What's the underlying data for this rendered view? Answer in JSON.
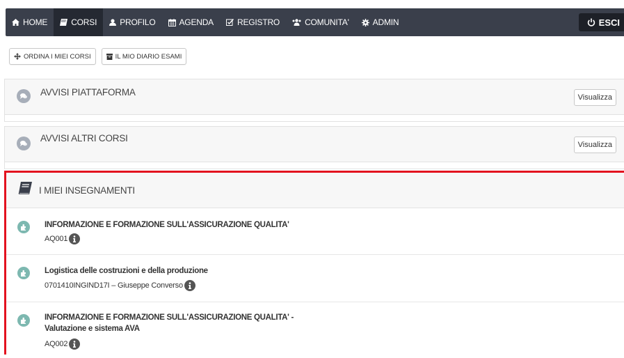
{
  "nav": {
    "items": [
      {
        "label": "HOME",
        "icon": "home-icon"
      },
      {
        "label": "CORSI",
        "icon": "book-icon",
        "active": true
      },
      {
        "label": "PROFILO",
        "icon": "user-icon"
      },
      {
        "label": "AGENDA",
        "icon": "calendar-icon"
      },
      {
        "label": "REGISTRO",
        "icon": "check-square-icon"
      },
      {
        "label": "COMUNITA'",
        "icon": "users-icon"
      },
      {
        "label": "ADMIN",
        "icon": "gear-icon"
      }
    ],
    "exit_label": "ESCI"
  },
  "toolbar": {
    "order_label": "ORDINA I MIEI CORSI",
    "diary_label": "IL MIO DIARIO ESAMI"
  },
  "notices": [
    {
      "title": "AVVISI PIATTAFORMA",
      "button": "Visualizza"
    },
    {
      "title": "AVVISI ALTRI CORSI",
      "button": "Visualizza"
    }
  ],
  "teachings": {
    "title": "I MIEI INSEGNAMENTI",
    "courses": [
      {
        "title": "INFORMAZIONE E FORMAZIONE SULL'ASSICURAZIONE QUALITA'",
        "code": "AQ001"
      },
      {
        "title": "Logistica delle costruzioni e della produzione",
        "code": "0701410INGIND17I –  Giuseppe Converso"
      },
      {
        "title": "INFORMAZIONE E FORMAZIONE SULL'ASSICURAZIONE QUALITA' - Valutazione e sistema AVA",
        "code": "AQ002"
      }
    ]
  },
  "colors": {
    "navbar": "#3a3f4b",
    "nav_active": "#252932",
    "highlight_border": "#e3121f",
    "puzzle_badge": "#7db8b0"
  }
}
